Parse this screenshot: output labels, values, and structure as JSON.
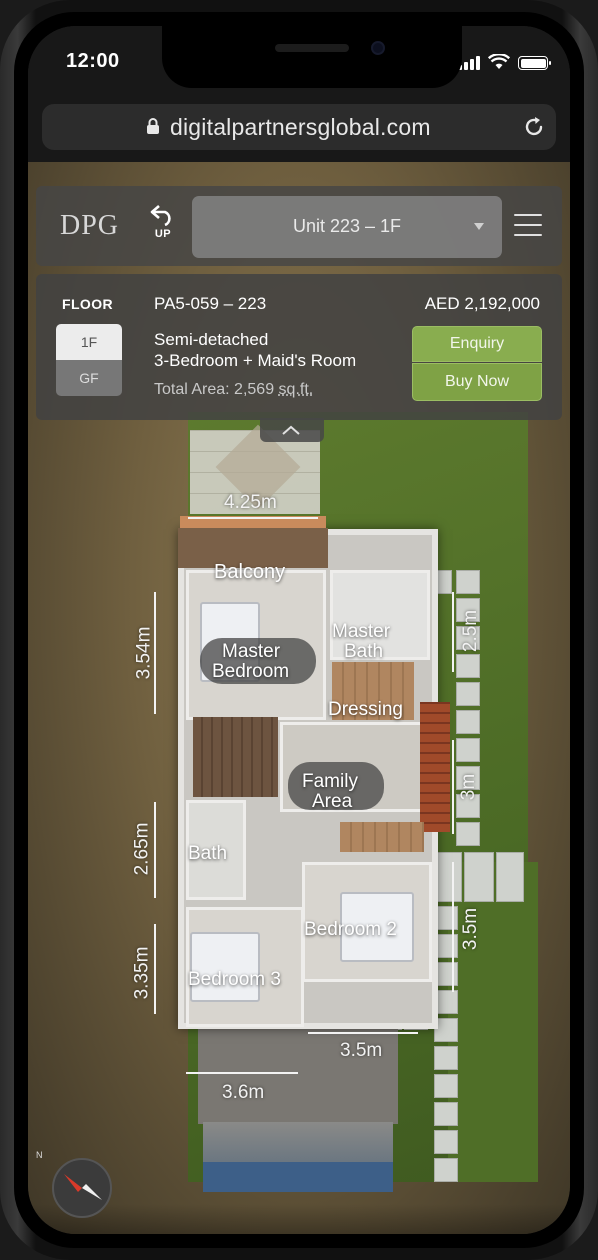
{
  "status_bar": {
    "time": "12:00"
  },
  "browser": {
    "url": "digitalpartnersglobal.com"
  },
  "header": {
    "logo": "DPG",
    "up_label": "UP",
    "unit_selector": "Unit 223 – 1F"
  },
  "info": {
    "floor_title": "FLOOR",
    "floor_options": [
      "1F",
      "GF"
    ],
    "selected_floor": "1F",
    "unit_code": "PA5-059 – 223",
    "price": "AED 2,192,000",
    "type_line1": "Semi-detached",
    "type_line2": "3-Bedroom + Maid's Room",
    "total_area_label": "Total Area: 2,569",
    "total_area_unit": "sq.ft.",
    "enquiry_label": "Enquiry",
    "buy_label": "Buy Now"
  },
  "plan": {
    "rooms": {
      "balcony": "Balcony",
      "master_bedroom_1": "Master",
      "master_bedroom_2": "Bedroom",
      "master_bath_1": "Master",
      "master_bath_2": "Bath",
      "dressing": "Dressing",
      "family_area_1": "Family",
      "family_area_2": "Area",
      "bath": "Bath",
      "bedroom_2": "Bedroom 2",
      "bedroom_3": "Bedroom 3"
    },
    "dimensions": {
      "top_width": "4.25m",
      "master_height": "3.54m",
      "master_bath_height": "2.5m",
      "stair_height": "3m",
      "bath_height": "2.65m",
      "bedroom2_height": "3.5m",
      "bedroom3_height": "3.35m",
      "bedroom2_width": "3.5m",
      "bedroom3_width": "3.6m"
    },
    "compass_label": "N"
  },
  "colors": {
    "accent_green": "#89ad4f",
    "panel_bg": "#424242"
  }
}
